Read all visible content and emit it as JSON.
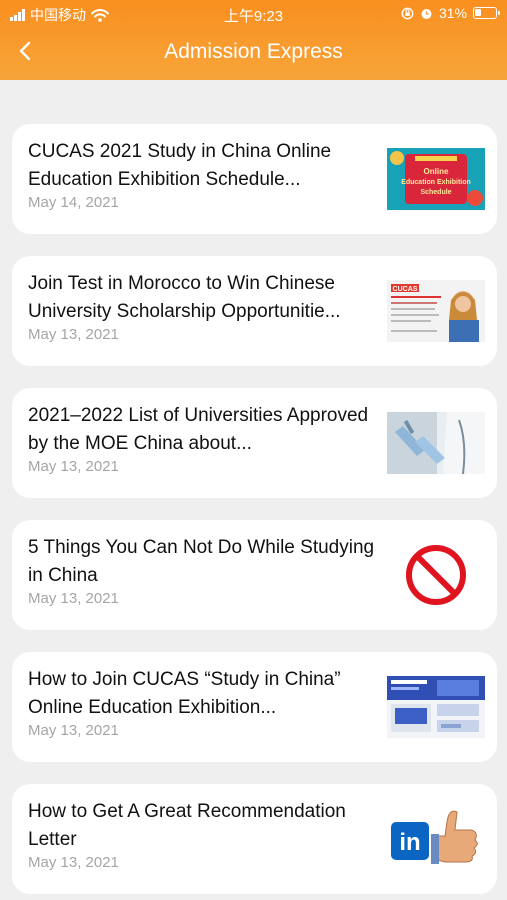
{
  "status_bar": {
    "carrier": "中国移动",
    "time": "上午9:23",
    "battery": "31%",
    "battery_level": 0.31,
    "icons": [
      "signal-icon",
      "wifi-icon",
      "lock-rotation-icon",
      "alarm-icon",
      "battery-icon"
    ]
  },
  "nav": {
    "title": "Admission Express",
    "back_icon": "chevron-left-icon"
  },
  "colors": {
    "header_top": "#f98f1f",
    "header_bottom": "#f7a53a",
    "background": "#efefef",
    "card": "#ffffff",
    "date_text": "#a5a5a5"
  },
  "articles": [
    {
      "title": "CUCAS 2021 Study in China Online Education Exhibition Schedule...",
      "date": "May 14, 2021",
      "thumb_text": "Online Education Exhibition Schedule"
    },
    {
      "title": "Join Test in Morocco to Win Chinese University Scholarship Opportunitie...",
      "date": "May 13, 2021",
      "thumb_text": "CUCAS"
    },
    {
      "title": "2021–2022 List of Universities Approved by the MOE China about...",
      "date": "May 13, 2021"
    },
    {
      "title": "5 Things You Can Not Do While Studying in China",
      "date": "May 13, 2021"
    },
    {
      "title": "How to Join CUCAS “Study in China” Online Education Exhibition...",
      "date": "May 13, 2021"
    },
    {
      "title": "How to Get A Great Recommendation Letter",
      "date": "May 13, 2021",
      "thumb_text": "in"
    }
  ]
}
